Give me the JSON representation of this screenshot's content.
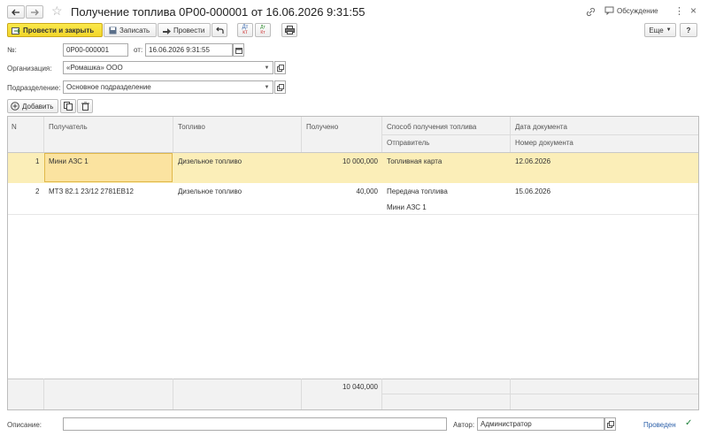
{
  "title": "Получение топлива 0Р00-000001 от 16.06.2026 9:31:55",
  "header_right": {
    "discuss_label": "Обсуждение"
  },
  "toolbar": {
    "post_close_label": "Провести и закрыть",
    "save_label": "Записать",
    "post_label": "Провести",
    "more_label": "Еще",
    "help_label": "?",
    "dt_label": "Дт",
    "kt_label": "Кт",
    "dtkt_top": "Дт",
    "dtkt_bottom": "кт"
  },
  "form": {
    "number_label": "№:",
    "number_value": "0Р00-000001",
    "date_label": "от:",
    "date_value": "16.06.2026  9:31:55",
    "org_label": "Организация:",
    "org_value": "«Ромашка» ООО",
    "dept_label": "Подразделение:",
    "dept_value": "Основное подразделение"
  },
  "table_toolbar": {
    "add_label": "Добавить"
  },
  "table": {
    "headers": {
      "n": "N",
      "recipient": "Получатель",
      "fuel": "Топливо",
      "received": "Получено",
      "method": "Способ получения топлива",
      "sender": "Отправитель",
      "doc_date": "Дата документа",
      "doc_number": "Номер документа"
    },
    "rows": [
      {
        "n": "1",
        "recipient": "Мини АЗС 1",
        "fuel": "Дизельное топливо",
        "received": "10 000,000",
        "method": "Топливная карта",
        "sender": "",
        "doc_date": "12.06.2026",
        "doc_number": ""
      },
      {
        "n": "2",
        "recipient": "МТЗ 82.1 23/12 2781ЕВ12",
        "fuel": "Дизельное топливо",
        "received": "40,000",
        "method": "Передача топлива",
        "sender": "Мини АЗС 1",
        "doc_date": "15.06.2026",
        "doc_number": ""
      }
    ],
    "total_received": "10 040,000"
  },
  "footer": {
    "comment_label": "Описание:",
    "comment_value": "",
    "author_label": "Автор:",
    "author_value": "Администратор",
    "status_label": "Проведен"
  },
  "colors": {
    "accent_yellow": "#f2d62a",
    "selected_row": "#fbeeb8",
    "selected_cell": "#fbe3a0",
    "status_green": "#1a7f37"
  }
}
